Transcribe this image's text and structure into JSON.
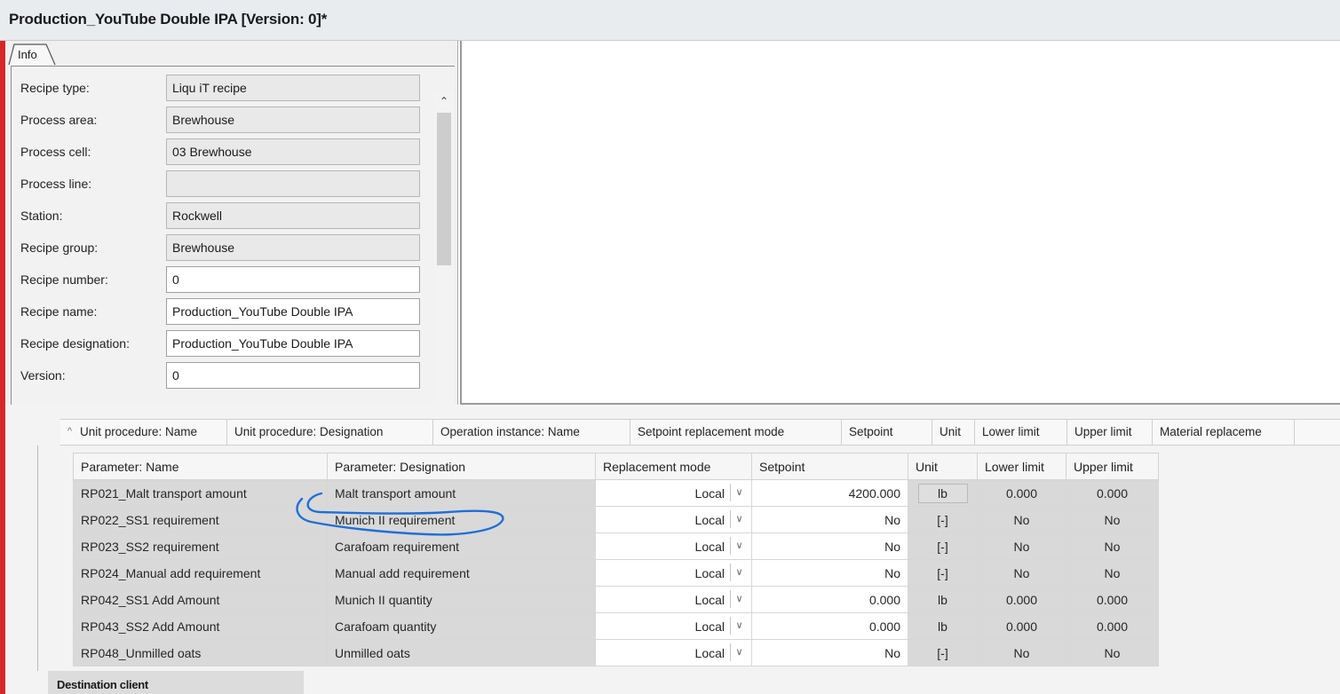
{
  "window": {
    "title": "Production_YouTube Double IPA [Version: 0]*"
  },
  "info_tab": {
    "label": "Info"
  },
  "info_fields": [
    {
      "label": "Recipe type:",
      "value": "Liqu iT recipe",
      "editable": false
    },
    {
      "label": "Process area:",
      "value": "Brewhouse",
      "editable": false
    },
    {
      "label": "Process cell:",
      "value": "03 Brewhouse",
      "editable": false
    },
    {
      "label": "Process line:",
      "value": "",
      "editable": false
    },
    {
      "label": "Station:",
      "value": "Rockwell",
      "editable": false
    },
    {
      "label": "Recipe group:",
      "value": "Brewhouse",
      "editable": false
    },
    {
      "label": "Recipe number:",
      "value": "0",
      "editable": true
    },
    {
      "label": "Recipe name:",
      "value": "Production_YouTube Double IPA",
      "editable": true
    },
    {
      "label": "Recipe designation:",
      "value": "Production_YouTube Double IPA",
      "editable": true
    },
    {
      "label": "Version:",
      "value": "0",
      "editable": true
    }
  ],
  "grid_header": [
    "Unit procedure: Name",
    "Unit procedure: Designation",
    "Operation instance: Name",
    "Setpoint replacement mode",
    "Setpoint",
    "Unit",
    "Lower limit",
    "Upper limit",
    "Material replaceme"
  ],
  "param_columns": [
    "Parameter: Name",
    "Parameter: Designation",
    "Replacement mode",
    "Setpoint",
    "Unit",
    "Lower limit",
    "Upper limit"
  ],
  "param_rows": [
    {
      "name": "RP021_Malt transport amount",
      "designation": "Malt transport amount",
      "mode": "Local",
      "setpoint": "4200.000",
      "unit": "lb",
      "lower": "0.000",
      "upper": "0.000"
    },
    {
      "name": "RP022_SS1 requirement",
      "designation": "Munich II requirement",
      "mode": "Local",
      "setpoint": "No",
      "unit": "[-]",
      "lower": "No",
      "upper": "No"
    },
    {
      "name": "RP023_SS2 requirement",
      "designation": "Carafoam requirement",
      "mode": "Local",
      "setpoint": "No",
      "unit": "[-]",
      "lower": "No",
      "upper": "No"
    },
    {
      "name": "RP024_Manual add requirement",
      "designation": "Manual add requirement",
      "mode": "Local",
      "setpoint": "No",
      "unit": "[-]",
      "lower": "No",
      "upper": "No"
    },
    {
      "name": "RP042_SS1 Add Amount",
      "designation": "Munich II quantity",
      "mode": "Local",
      "setpoint": "0.000",
      "unit": "lb",
      "lower": "0.000",
      "upper": "0.000"
    },
    {
      "name": "RP043_SS2 Add Amount",
      "designation": "Carafoam quantity",
      "mode": "Local",
      "setpoint": "0.000",
      "unit": "lb",
      "lower": "0.000",
      "upper": "0.000"
    },
    {
      "name": "RP048_Unmilled oats",
      "designation": "Unmilled oats",
      "mode": "Local",
      "setpoint": "No",
      "unit": "[-]",
      "lower": "No",
      "upper": "No"
    }
  ],
  "destination": {
    "label": "Destination client"
  },
  "colors": {
    "accent_red": "#d62828",
    "annotation_blue": "#1f6fd6",
    "readonly_gray": "#d9d9d9"
  },
  "icons": {
    "scroll_up": "chevron-up-icon",
    "scroll_down": "chevron-down-icon",
    "dropdown": "chevron-down-icon",
    "sort": "sort-asc-icon"
  }
}
